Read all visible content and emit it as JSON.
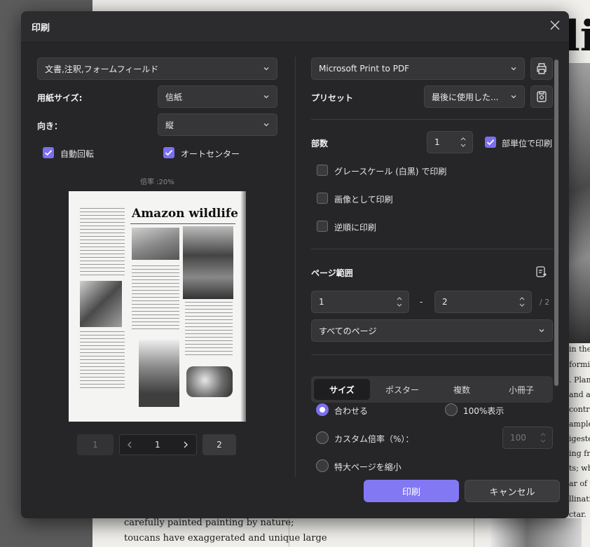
{
  "dialog": {
    "title": "印刷"
  },
  "left": {
    "content_select": "文書,注釈,フォームフィールド",
    "paper_size_label": "用紙サイズ:",
    "paper_size_value": "信紙",
    "orientation_label": "向き：",
    "orientation_value": "縦",
    "auto_rotate_label": "自動回転",
    "auto_center_label": "オートセンター",
    "zoom_caption": "倍率 :20%",
    "preview_headline": "Amazon wildlife",
    "pager": {
      "first": "1",
      "current": "1",
      "last": "2"
    }
  },
  "right": {
    "printer": "Microsoft Print to PDF",
    "preset_label": "プリセット",
    "preset_value": "最後に使用した...",
    "copies_label": "部数",
    "copies_value": "1",
    "collate_label": "部単位で印刷",
    "grayscale_label": "グレースケール (白黒) で印刷",
    "as_image_label": "画像として印刷",
    "reverse_label": "逆順に印刷",
    "page_range_label": "ページ範囲",
    "range_from": "1",
    "range_sep": "-",
    "range_to": "2",
    "range_total": "/ 2",
    "pages_select": "すべてのページ",
    "tabs": [
      "サイズ",
      "ポスター",
      "複数",
      "小冊子"
    ],
    "fit_label": "合わせる",
    "actual_label": "100%表示",
    "custom_label": "カスタム倍率（%）：",
    "custom_value": "100",
    "shrink_label": "特大ページを縮小"
  },
  "footer": {
    "print_label": "印刷",
    "cancel_label": "キャンセル"
  },
  "background": {
    "title_fragment": "lif",
    "lines_bottom": [
      "carefully painted painting by nature;",
      "toucans have exaggerated and unique large"
    ],
    "right_fragments": [
      "in the",
      "forming",
      ". Plan",
      "and ar",
      "contro",
      "ample",
      "igested",
      "ing fruit",
      "ts; wh",
      "ar of p",
      "llinati",
      "ctar."
    ]
  },
  "colors": {
    "accent": "#8378f4",
    "dialog_bg": "#262628"
  }
}
